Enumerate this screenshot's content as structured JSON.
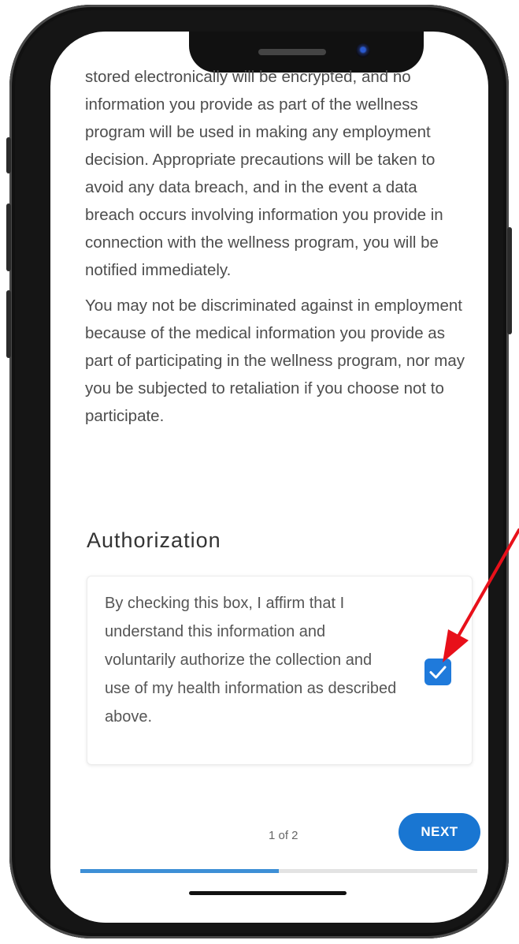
{
  "consent": {
    "paragraphs": [
      "stored electronically will be encrypted, and no information you provide as part of the wellness program will be used in making any employment decision. Appropriate precautions will be taken to avoid any data breach, and in the event a data breach occurs involving information you provide in connection with the wellness program, you will be notified immediately.",
      "You may not be discriminated against in employment because of the medical information you provide as part of participating in the wellness program, nor may you be subjected to retaliation if you choose not to participate."
    ]
  },
  "authorization": {
    "title": "Authorization",
    "text": "By checking this box, I affirm that I understand this information and voluntarily authorize the collection and use of my health information as described above.",
    "checked": true
  },
  "footer": {
    "pager": "1 of 2",
    "next_label": "NEXT",
    "progress": 0.5
  },
  "colors": {
    "accent": "#1976d2",
    "checkbox": "#1f7adb",
    "annotation_arrow": "#e8101a"
  }
}
